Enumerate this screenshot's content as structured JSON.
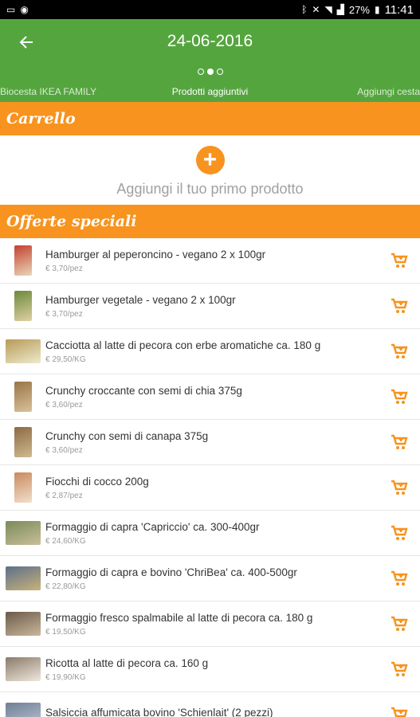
{
  "status_bar": {
    "battery": "27%",
    "time": "11:41"
  },
  "header": {
    "title": "24-06-2016",
    "tabs": [
      {
        "label": "Biocesta IKEA FAMILY"
      },
      {
        "label": "Prodotti aggiuntivi"
      },
      {
        "label": "Aggiungi cesta"
      }
    ]
  },
  "cart": {
    "heading": "Carrello",
    "empty_text": "Aggiungi il tuo primo prodotto"
  },
  "offers": {
    "heading": "Offerte speciali",
    "items": [
      {
        "name": "Hamburger al peperoncino - vegano 2 x 100gr",
        "price": "€ 3,70/pez",
        "thumb": "tall"
      },
      {
        "name": "Hamburger vegetale - vegano 2 x 100gr",
        "price": "€ 3,70/pez",
        "thumb": "tall"
      },
      {
        "name": "Cacciotta al latte di pecora con erbe aromatiche ca. 180 g",
        "price": "€ 29,50/KG",
        "thumb": "wide"
      },
      {
        "name": "Crunchy croccante con semi di chia 375g",
        "price": "€ 3,60/pez",
        "thumb": "tall"
      },
      {
        "name": "Crunchy con semi di canapa 375g",
        "price": "€ 3,60/pez",
        "thumb": "tall"
      },
      {
        "name": "Fiocchi di cocco 200g",
        "price": "€ 2,87/pez",
        "thumb": "tall"
      },
      {
        "name": "Formaggio di capra 'Capriccio' ca. 300-400gr",
        "price": "€ 24,60/KG",
        "thumb": "wide"
      },
      {
        "name": "Formaggio di capra e bovino 'ChriBea' ca. 400-500gr",
        "price": "€ 22,80/KG",
        "thumb": "wide"
      },
      {
        "name": "Formaggio fresco spalmabile al latte di pecora ca. 180 g",
        "price": "€ 19,50/KG",
        "thumb": "wide"
      },
      {
        "name": "Ricotta al latte di pecora ca. 160 g",
        "price": "€ 19,90/KG",
        "thumb": "wide"
      },
      {
        "name": "Salsiccia affumicata bovino 'Schienlait' (2 pezzi)",
        "price": "",
        "thumb": "wide"
      }
    ]
  },
  "colors": {
    "header_green": "#55a53f",
    "accent_orange": "#f7931e"
  }
}
